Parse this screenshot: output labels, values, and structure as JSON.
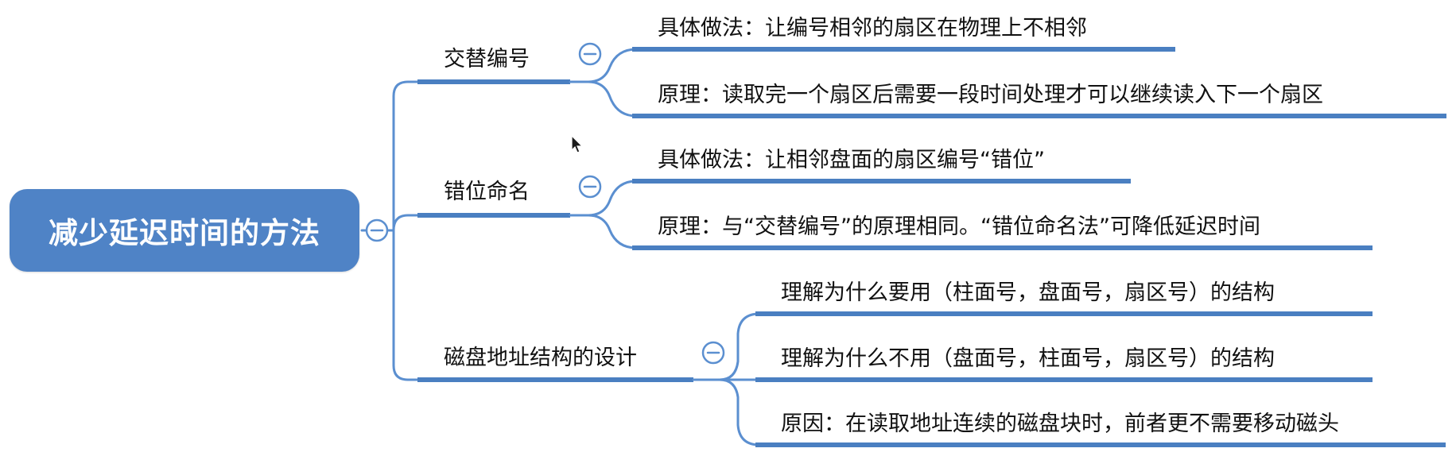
{
  "root": {
    "label": "减少延迟时间的方法"
  },
  "branches": [
    {
      "label": "交替编号",
      "children": [
        "具体做法：让编号相邻的扇区在物理上不相邻",
        "原理：读取完一个扇区后需要一段时间处理才可以继续读入下一个扇区"
      ]
    },
    {
      "label": "错位命名",
      "children": [
        "具体做法：让相邻盘面的扇区编号“错位”",
        "原理：与“交替编号”的原理相同。“错位命名法”可降低延迟时间"
      ]
    },
    {
      "label": "磁盘地址结构的设计",
      "children": [
        "理解为什么要用（柱面号，盘面号，扇区号）的结构",
        "理解为什么不用（盘面号，柱面号，扇区号）的结构",
        "原因：在读取地址连续的磁盘块时，前者更不需要移动磁头"
      ]
    }
  ],
  "icons": {
    "collapse": "collapse-minus-icon",
    "cursor": "mouse-pointer-icon"
  },
  "colors": {
    "root_fill": "#4f83c6",
    "connector": "#5b8fd0",
    "underline": "#4a7fc1",
    "text": "#111111",
    "background": "#ffffff"
  }
}
